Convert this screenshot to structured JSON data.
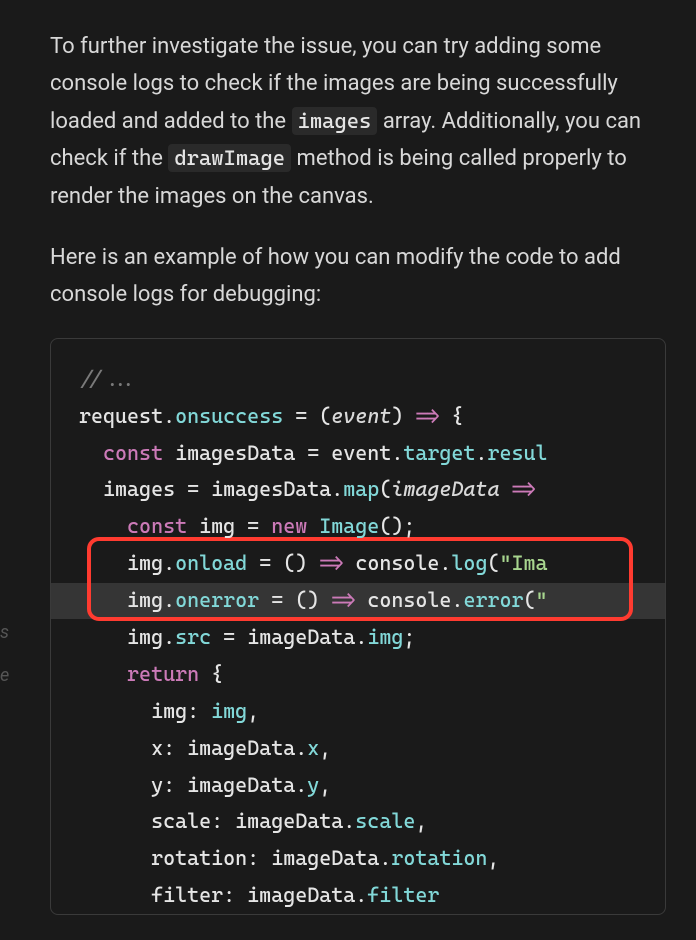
{
  "text": {
    "para1_before_code1": "To further investigate the issue, you can try adding some console logs to check if the images are being successfully loaded and added to the ",
    "code1": "images",
    "para1_mid": " array. Additionally, you can check if the ",
    "code2": "drawImage",
    "para1_after": " method is being called properly to render the images on the canvas.",
    "para2": "Here is an example of how you can modify the code to add console logs for debugging:"
  },
  "code": {
    "line1_comment": "//...",
    "line2_a": "request",
    "line2_b": ".",
    "line2_c": "onsuccess",
    "line2_d": " = ",
    "line2_e": "(",
    "line2_f": "event",
    "line2_g": ")",
    "line2_h": " => ",
    "line2_i": "{",
    "line3_a": "  const",
    "line3_b": " imagesData ",
    "line3_c": "=",
    "line3_d": " event",
    "line3_e": ".",
    "line3_f": "target",
    "line3_g": ".",
    "line3_h": "resul",
    "line4_a": "  images ",
    "line4_b": "=",
    "line4_c": " imagesData",
    "line4_d": ".",
    "line4_e": "map",
    "line4_f": "(",
    "line4_g": "imageData",
    "line4_h": " => ",
    "line5_a": "    const",
    "line5_b": " img ",
    "line5_c": "=",
    "line5_d": " new",
    "line5_e": " Image",
    "line5_f": "();",
    "line6_a": "    img",
    "line6_b": ".",
    "line6_c": "onload",
    "line6_d": " = ",
    "line6_e": "()",
    "line6_f": " => ",
    "line6_g": "console",
    "line6_h": ".",
    "line6_i": "log",
    "line6_j": "(",
    "line6_k": "\"Ima",
    "line7_a": "    img",
    "line7_b": ".",
    "line7_c": "onerror",
    "line7_d": " = ",
    "line7_e": "()",
    "line7_f": " => ",
    "line7_g": "console",
    "line7_h": ".",
    "line7_i": "error",
    "line7_j": "(",
    "line7_k": "\"",
    "line8_a": "    img",
    "line8_b": ".",
    "line8_c": "src",
    "line8_d": " = ",
    "line8_e": "imageData",
    "line8_f": ".",
    "line8_g": "img",
    "line8_h": ";",
    "line9_a": "    return",
    "line9_b": " {",
    "line10_a": "      img",
    "line10_b": ": ",
    "line10_c": "img",
    "line10_d": ",",
    "line11_a": "      x",
    "line11_b": ": ",
    "line11_c": "imageData",
    "line11_d": ".",
    "line11_e": "x",
    "line11_f": ",",
    "line12_a": "      y",
    "line12_b": ": ",
    "line12_c": "imageData",
    "line12_d": ".",
    "line12_e": "y",
    "line12_f": ",",
    "line13_a": "      scale",
    "line13_b": ": ",
    "line13_c": "imageData",
    "line13_d": ".",
    "line13_e": "scale",
    "line13_f": ",",
    "line14_a": "      rotation",
    "line14_b": ": ",
    "line14_c": "imageData",
    "line14_d": ".",
    "line14_e": "rotation",
    "line14_f": ",",
    "line15_a": "      filter",
    "line15_b": ": ",
    "line15_c": "imageData",
    "line15_d": ".",
    "line15_e": "filter"
  },
  "left_edge": {
    "char1": "s",
    "char2": "e"
  }
}
